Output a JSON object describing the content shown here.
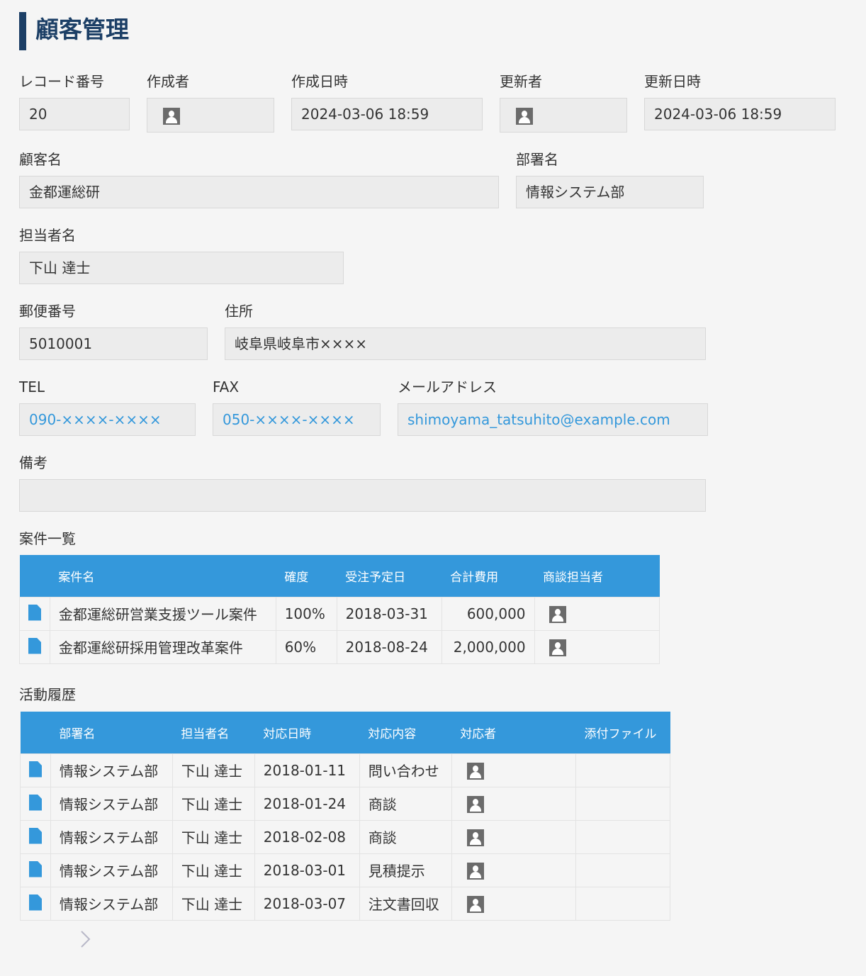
{
  "page_title": "顧客管理",
  "colors": {
    "accent": "#3498db",
    "title": "#1c3f66"
  },
  "fields": {
    "record_no": {
      "label": "レコード番号",
      "value": "20"
    },
    "creator": {
      "label": "作成者"
    },
    "created_at": {
      "label": "作成日時",
      "value": "2024-03-06 18:59"
    },
    "updater": {
      "label": "更新者"
    },
    "updated_at": {
      "label": "更新日時",
      "value": "2024-03-06 18:59"
    },
    "customer_name": {
      "label": "顧客名",
      "value": "金都運総研"
    },
    "department": {
      "label": "部署名",
      "value": "情報システム部"
    },
    "person": {
      "label": "担当者名",
      "value": "下山 達士"
    },
    "postal": {
      "label": "郵便番号",
      "value": "5010001"
    },
    "address": {
      "label": "住所",
      "value": "岐阜県岐阜市××××"
    },
    "tel": {
      "label": "TEL",
      "value": "090-××××-××××"
    },
    "fax": {
      "label": "FAX",
      "value": "050-××××-××××"
    },
    "email": {
      "label": "メールアドレス",
      "value": "shimoyama_tatsuhito@example.com"
    },
    "notes": {
      "label": "備考",
      "value": ""
    }
  },
  "deals": {
    "label": "案件一覧",
    "headers": [
      "案件名",
      "確度",
      "受注予定日",
      "合計費用",
      "商談担当者"
    ],
    "rows": [
      {
        "name": "金都運総研営業支援ツール案件",
        "probability": "100%",
        "date": "2018-03-31",
        "cost": "600,000"
      },
      {
        "name": "金都運総研採用管理改革案件",
        "probability": "60%",
        "date": "2018-08-24",
        "cost": "2,000,000"
      }
    ]
  },
  "activities": {
    "label": "活動履歴",
    "headers": [
      "部署名",
      "担当者名",
      "対応日時",
      "対応内容",
      "対応者",
      "添付ファイル"
    ],
    "rows": [
      {
        "dept": "情報システム部",
        "person": "下山 達士",
        "date": "2018-01-11",
        "content": "問い合わせ"
      },
      {
        "dept": "情報システム部",
        "person": "下山 達士",
        "date": "2018-01-24",
        "content": "商談"
      },
      {
        "dept": "情報システム部",
        "person": "下山 達士",
        "date": "2018-02-08",
        "content": "商談"
      },
      {
        "dept": "情報システム部",
        "person": "下山 達士",
        "date": "2018-03-01",
        "content": "見積提示"
      },
      {
        "dept": "情報システム部",
        "person": "下山 達士",
        "date": "2018-03-07",
        "content": "注文書回収"
      }
    ]
  }
}
